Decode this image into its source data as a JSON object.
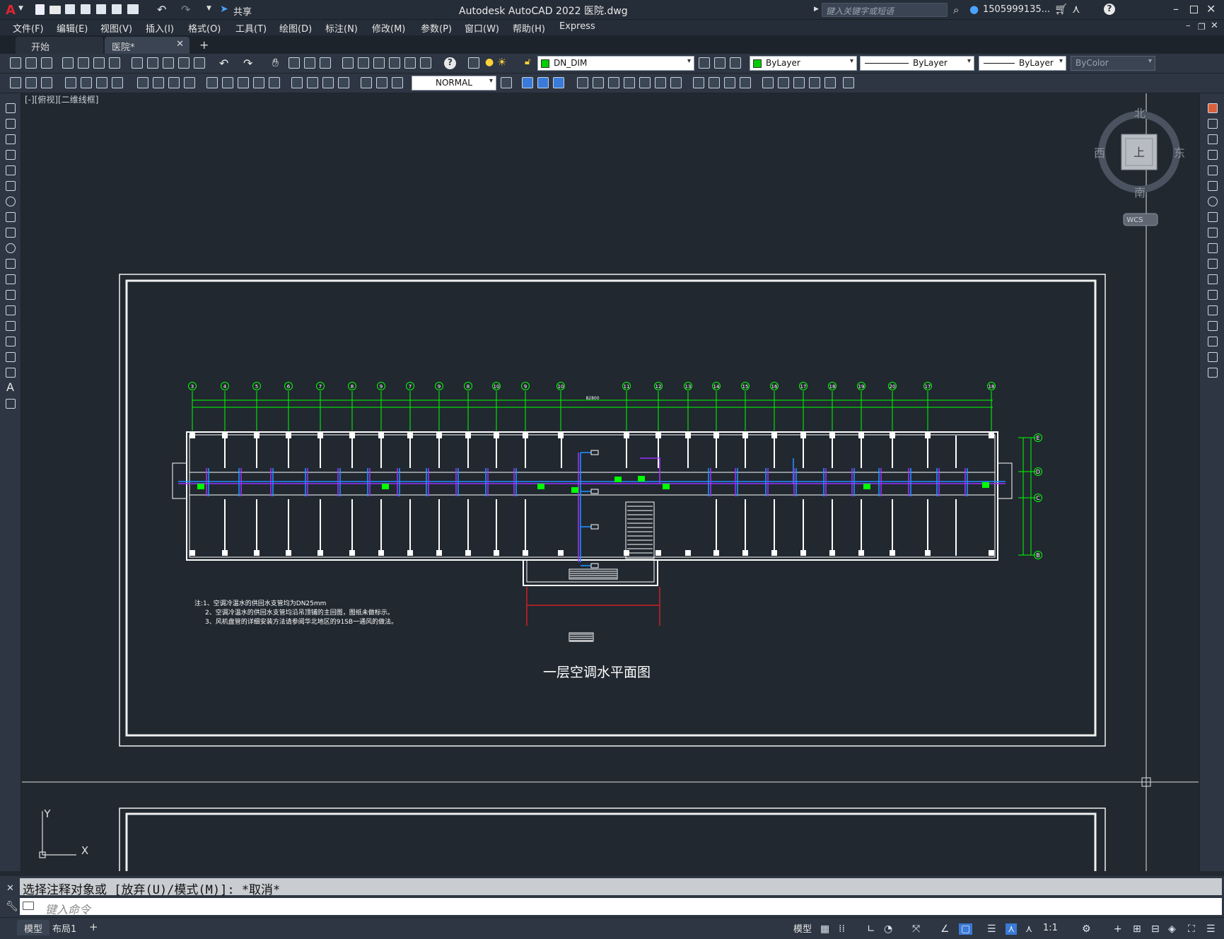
{
  "app": {
    "title": "Autodesk AutoCAD 2022    医院.dwg",
    "search_placeholder": "键入关键字或短语",
    "user": "1505999135...",
    "share": "共享"
  },
  "menu": [
    "文件(F)",
    "编辑(E)",
    "视图(V)",
    "插入(I)",
    "格式(O)",
    "工具(T)",
    "绘图(D)",
    "标注(N)",
    "修改(M)",
    "参数(P)",
    "窗口(W)",
    "帮助(H)",
    "Express"
  ],
  "tabs": {
    "start": "开始",
    "active": "医院*"
  },
  "toolbar": {
    "layer": "DN_DIM",
    "color": "ByLayer",
    "linetype": "ByLayer",
    "lineweight": "ByLayer",
    "plotstyle": "ByColor",
    "dimstyle": "NORMAL"
  },
  "viewport": {
    "label": "[-][俯视][二维线框]"
  },
  "viewcube": {
    "north": "北",
    "south": "南",
    "east": "东",
    "west": "西",
    "top": "上",
    "wcs": "WCS"
  },
  "ucs": {
    "x": "X",
    "y": "Y"
  },
  "drawing": {
    "title": "一层空调水平面图",
    "notes": [
      "注:1、空调冷温水的供回水支管均为DN25mm",
      "2、空调冷温水的供回水支管均沿吊顶铺的主回图，图纸未做标示。",
      "3、风机盘管的详细安装方法请参阅华北地区的91SB一通风的做法。"
    ],
    "top_axis_labels": [
      "3",
      "4",
      "5",
      "6",
      "7",
      "8",
      "9",
      "7",
      "9",
      "8",
      "10",
      "9",
      "10",
      "11",
      "12",
      "13",
      "14",
      "15",
      "16",
      "17",
      "18",
      "19",
      "20",
      "17",
      "18"
    ],
    "right_axis_labels": [
      "E",
      "D",
      "C",
      "B"
    ],
    "overall_dimension": "82800"
  },
  "command": {
    "history": "选择注释对象或 [放弃(U)/模式(M)]: *取消*",
    "placeholder": "键入命令"
  },
  "layout_tabs": {
    "model": "模型",
    "layout1": "布局1"
  },
  "status": {
    "model": "模型",
    "scale": "1:1"
  },
  "colors": {
    "background": "#212830",
    "layer_swatch": "#00cc00",
    "pipe_purple": "#9a30ff",
    "pipe_blue": "#1f8fff",
    "grid_green": "#00ff00",
    "wall": "#ffffff",
    "stair_red": "#cc2020"
  }
}
